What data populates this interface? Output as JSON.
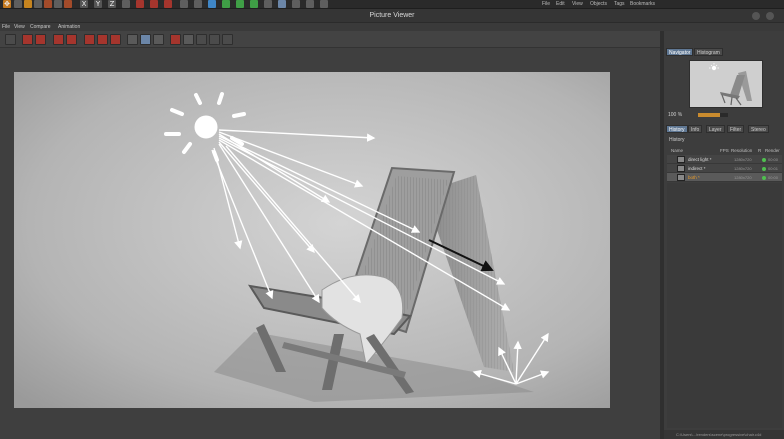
{
  "window": {
    "title": "Picture Viewer"
  },
  "app_toolbar": {
    "letters": [
      "X",
      "Y",
      "Z"
    ],
    "menus": [
      "File",
      "Edit",
      "View",
      "Objects",
      "Tags",
      "Bookmarks"
    ]
  },
  "menu": {
    "items": [
      "File",
      "View",
      "Compare",
      "Animation"
    ]
  },
  "right_panel": {
    "tabs": [
      "Navigator",
      "Histogram"
    ],
    "zoom": {
      "label": "100 %",
      "fraction": 0.72
    },
    "history_tabs": [
      "History",
      "Info",
      "Layer",
      "Filter",
      "Stereo"
    ],
    "history_title": "History",
    "columns": [
      "Name",
      "FPS",
      "Resolution",
      "R",
      "Render"
    ],
    "rows": [
      {
        "name": "direct light *",
        "res": "1280x720",
        "time": "00:00"
      },
      {
        "name": "indirect *",
        "res": "1280x720",
        "time": "00:01"
      },
      {
        "name": "both *",
        "res": "1280x720",
        "time": "00:00"
      }
    ],
    "selected_row": 2,
    "status_path": "C:\\Users\\...\\renders\\scene\\progressive\\chair.c4d"
  },
  "colors": {
    "accent": "#5f7793",
    "selected_text": "#e69a2b",
    "status_green": "#4fc04f",
    "red_icon": "#a5352d"
  },
  "icons": {
    "toolbar": [
      "undo-icon",
      "redo-icon",
      "render-region-icon",
      "render-view-icon",
      "render-picture-viewer-icon",
      "edit-render-settings-icon",
      "camera-icon",
      "view-icon",
      "lock-icon",
      "display-icon",
      "grid-icon",
      "zoom-icon",
      "snapshot-icon",
      "save-icon",
      "compare-icon",
      "color-icon",
      "copy-icon"
    ]
  }
}
